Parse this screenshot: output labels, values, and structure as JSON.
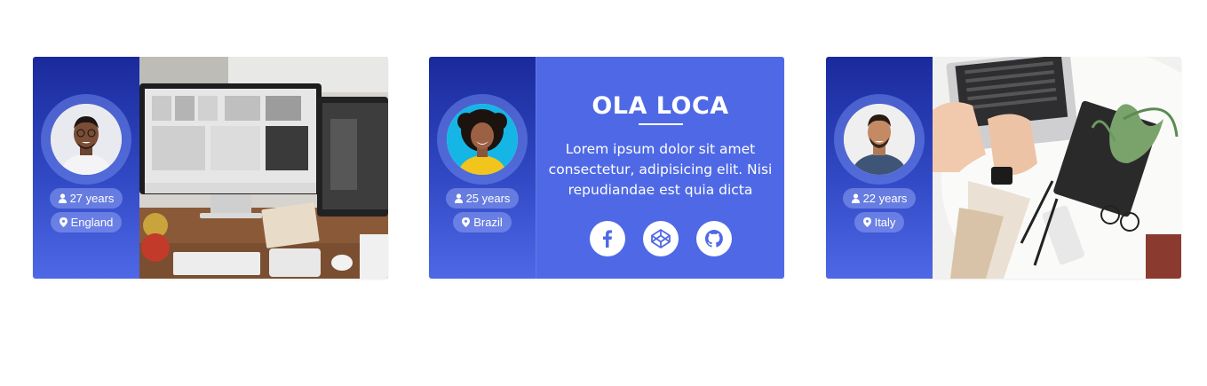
{
  "cards": [
    {
      "age": "27 years",
      "country": "England"
    },
    {
      "age": "25 years",
      "country": "Brazil",
      "name": "OLA LOCA",
      "bio": "Lorem ipsum dolor sit amet consectetur, adipisicing elit. Nisi repudiandae est quia dicta",
      "socials": [
        "facebook-icon",
        "codepen-icon",
        "github-icon"
      ]
    },
    {
      "age": "22 years",
      "country": "Italy"
    }
  ],
  "colors": {
    "side_top": "#1a2a9c",
    "side_bottom": "#4f68e6",
    "info_bg": "#4f69e6",
    "social_icon": "#4f69e6"
  }
}
